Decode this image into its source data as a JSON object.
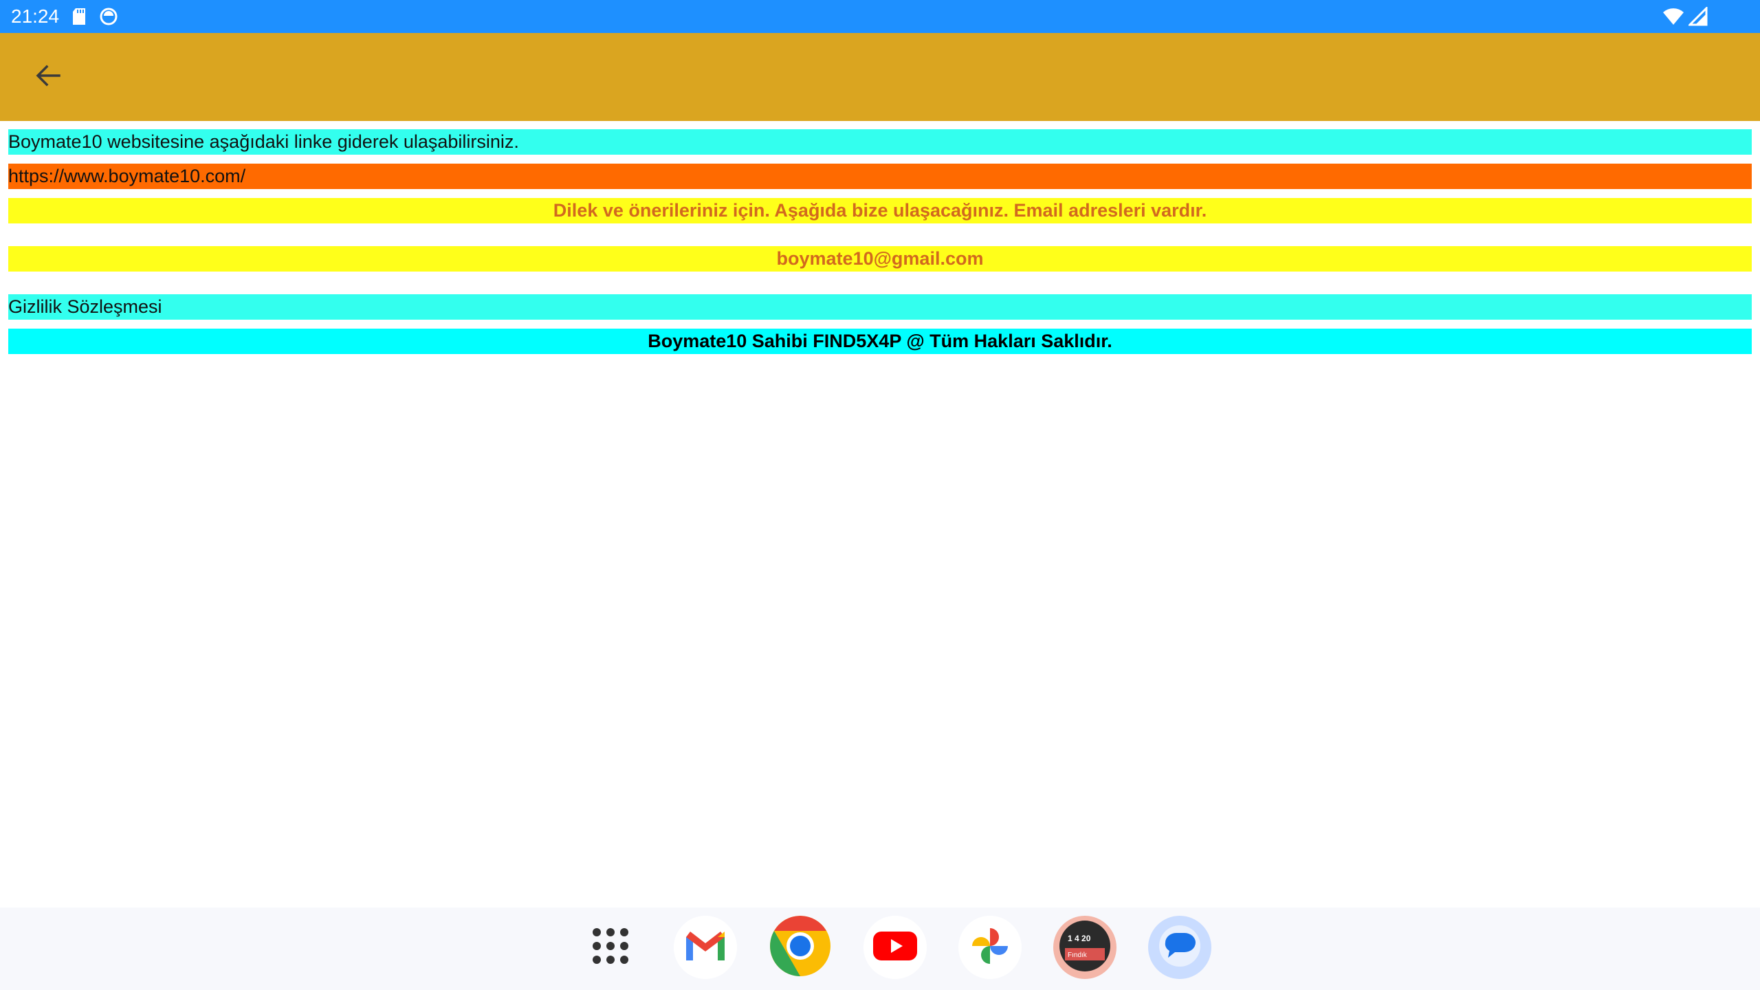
{
  "status_bar": {
    "time": "21:24",
    "icons_left": [
      "sd-card-icon",
      "sync-icon"
    ],
    "icons_right": [
      "wifi-icon",
      "signal-icon"
    ]
  },
  "app_bar": {
    "back_icon": "arrow-left-icon",
    "color": "#daa520"
  },
  "content": {
    "website_intro": "Boymate10  websitesine aşağıdaki linke giderek ulaşabilirsiniz.",
    "website_url": "https://www.boymate10.com/",
    "contact_intro": "Dilek ve önerileriniz için. Aşağıda bize ulaşacağınız. Email adresleri vardır.",
    "email": "boymate10@gmail.com",
    "privacy": "Gizlilik Sözleşmesi",
    "copyright": "Boymate10 Sahibi FIND5X4P @ Tüm Hakları Saklıdır."
  },
  "dock": {
    "apps": [
      {
        "name": "app-drawer",
        "icon": "grid-dots-icon"
      },
      {
        "name": "gmail",
        "icon": "gmail-icon"
      },
      {
        "name": "chrome",
        "icon": "chrome-icon"
      },
      {
        "name": "youtube",
        "icon": "youtube-icon"
      },
      {
        "name": "photos",
        "icon": "photos-icon"
      },
      {
        "name": "findik",
        "icon": "findik-app-icon"
      },
      {
        "name": "messages",
        "icon": "messages-icon"
      }
    ]
  }
}
